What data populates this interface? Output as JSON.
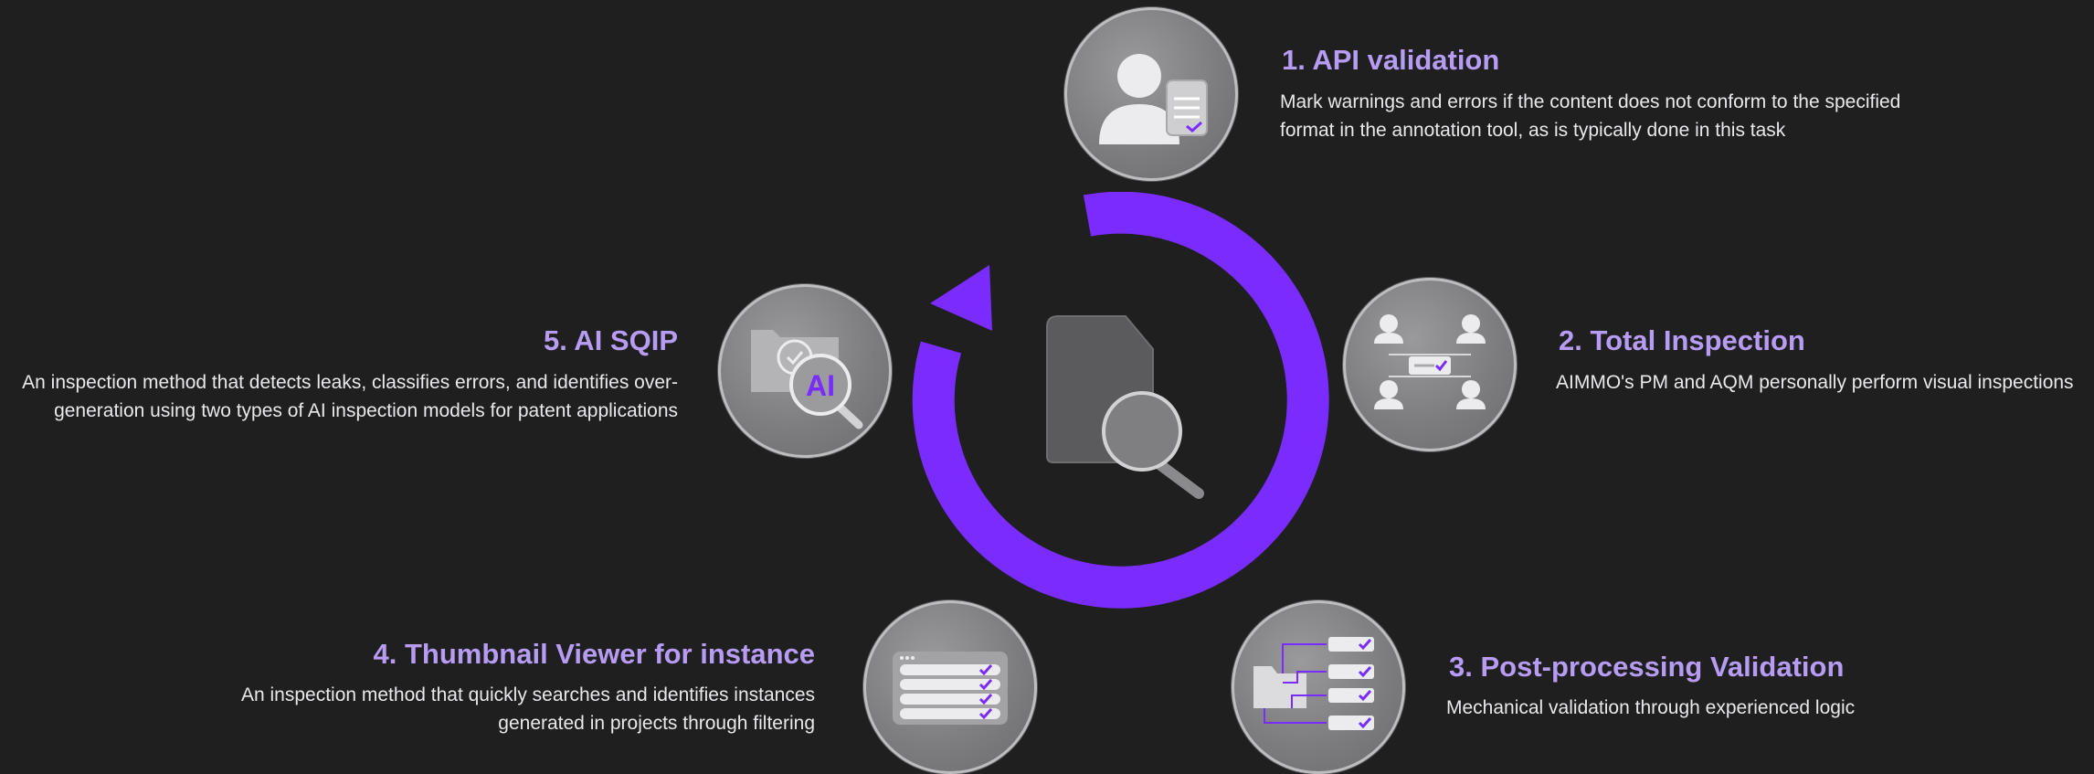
{
  "steps": [
    {
      "title": "1. API validation",
      "desc_lines": [
        "Mark warnings and errors if the content does not conform to the specified",
        "format in the annotation tool, as is typically done in this task"
      ],
      "icon": "user-document-icon"
    },
    {
      "title": "2. Total Inspection",
      "desc_lines": [
        "AIMMO's PM and AQM personally perform visual inspections"
      ],
      "icon": "team-review-icon"
    },
    {
      "title": "3. Post-processing Validation",
      "desc_lines": [
        "Mechanical validation through experienced logic"
      ],
      "icon": "folder-checklist-icon"
    },
    {
      "title": "4. Thumbnail Viewer for instance",
      "desc_lines": [
        "An inspection method that quickly searches and identifies instances",
        "generated in projects through filtering"
      ],
      "icon": "list-window-icon"
    },
    {
      "title": "5. AI SQIP",
      "desc_lines": [
        "An inspection method that detects leaks, classifies errors, and identifies over-",
        "generation using two types of AI inspection models for patent applications"
      ],
      "icon": "ai-magnifier-icon",
      "icon_text": "AI"
    }
  ],
  "colors": {
    "accent": "#7a2cff",
    "title": "#b69cf2",
    "background": "#1f1f20",
    "text": "#e9e9ec"
  }
}
